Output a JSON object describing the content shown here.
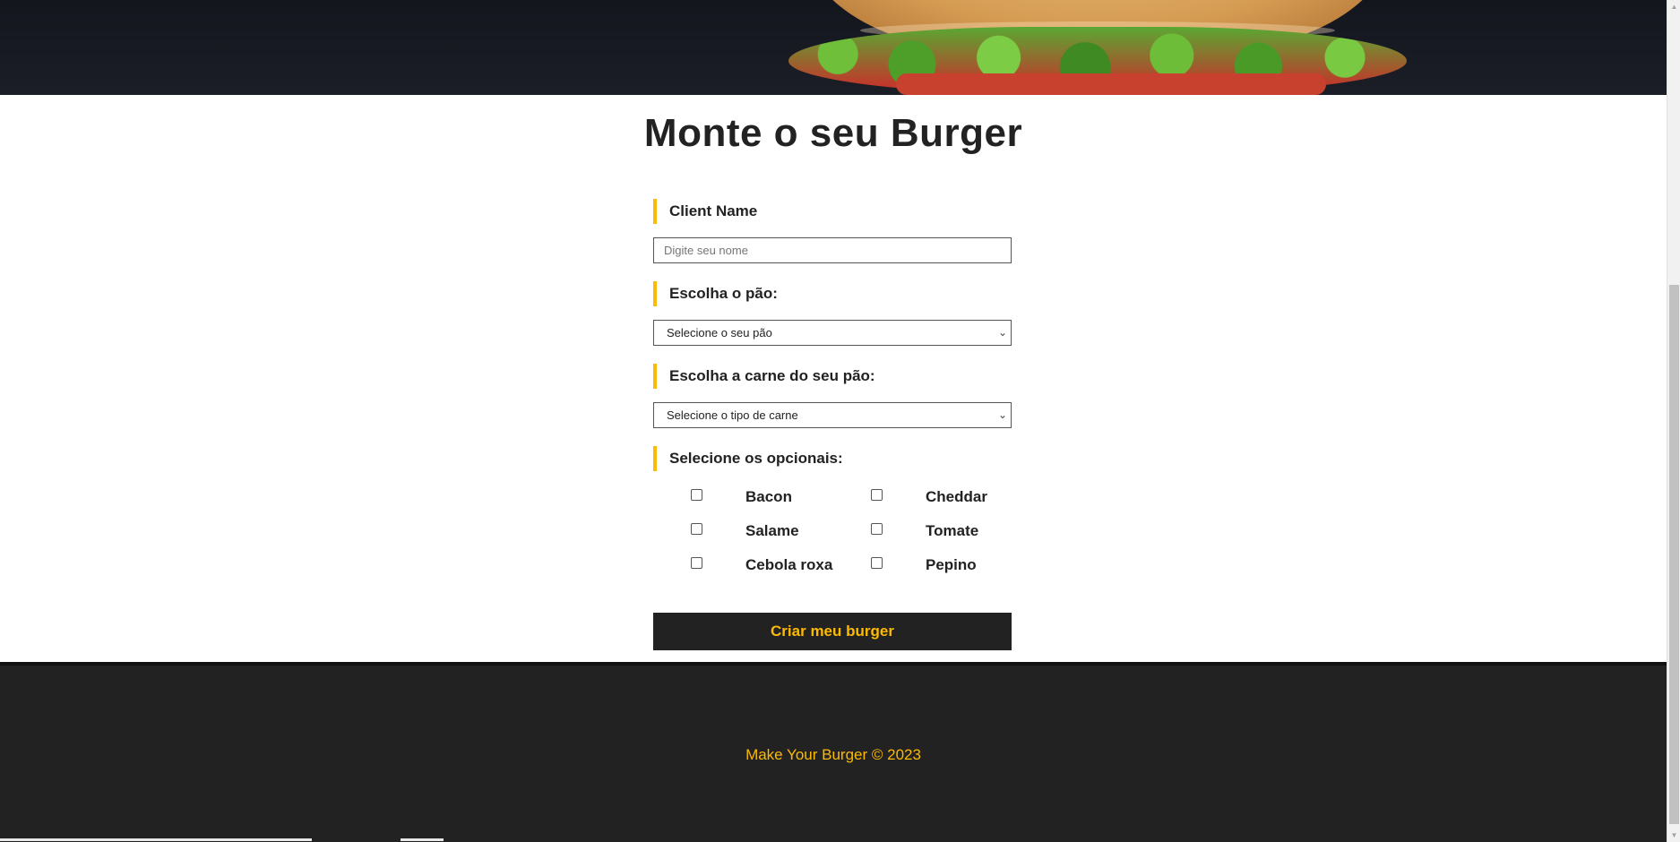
{
  "page": {
    "title": "Monte o seu Burger"
  },
  "form": {
    "name_label": "Client Name",
    "name_placeholder": "Digite seu nome",
    "name_value": "",
    "bread_label": "Escolha o pão:",
    "bread_selected": "Selecione o seu pão",
    "meat_label": "Escolha a carne do seu pão:",
    "meat_selected": "Selecione o tipo de carne",
    "optionals_label": "Selecione os opcionais:",
    "optionals": [
      {
        "label": "Bacon",
        "checked": false
      },
      {
        "label": "Cheddar",
        "checked": false
      },
      {
        "label": "Salame",
        "checked": false
      },
      {
        "label": "Tomate",
        "checked": false
      },
      {
        "label": "Cebola roxa",
        "checked": false
      },
      {
        "label": "Pepino",
        "checked": false
      }
    ],
    "submit_label": "Criar meu burger"
  },
  "footer": {
    "text": "Make Your Burger © 2023"
  },
  "icons": {
    "select_arrow": "chevron-down-icon",
    "checkbox": "checkbox-icon",
    "hero_image": "burger-image"
  },
  "colors": {
    "accent": "#fcba03",
    "dark": "#222222",
    "background": "#ffffff"
  }
}
